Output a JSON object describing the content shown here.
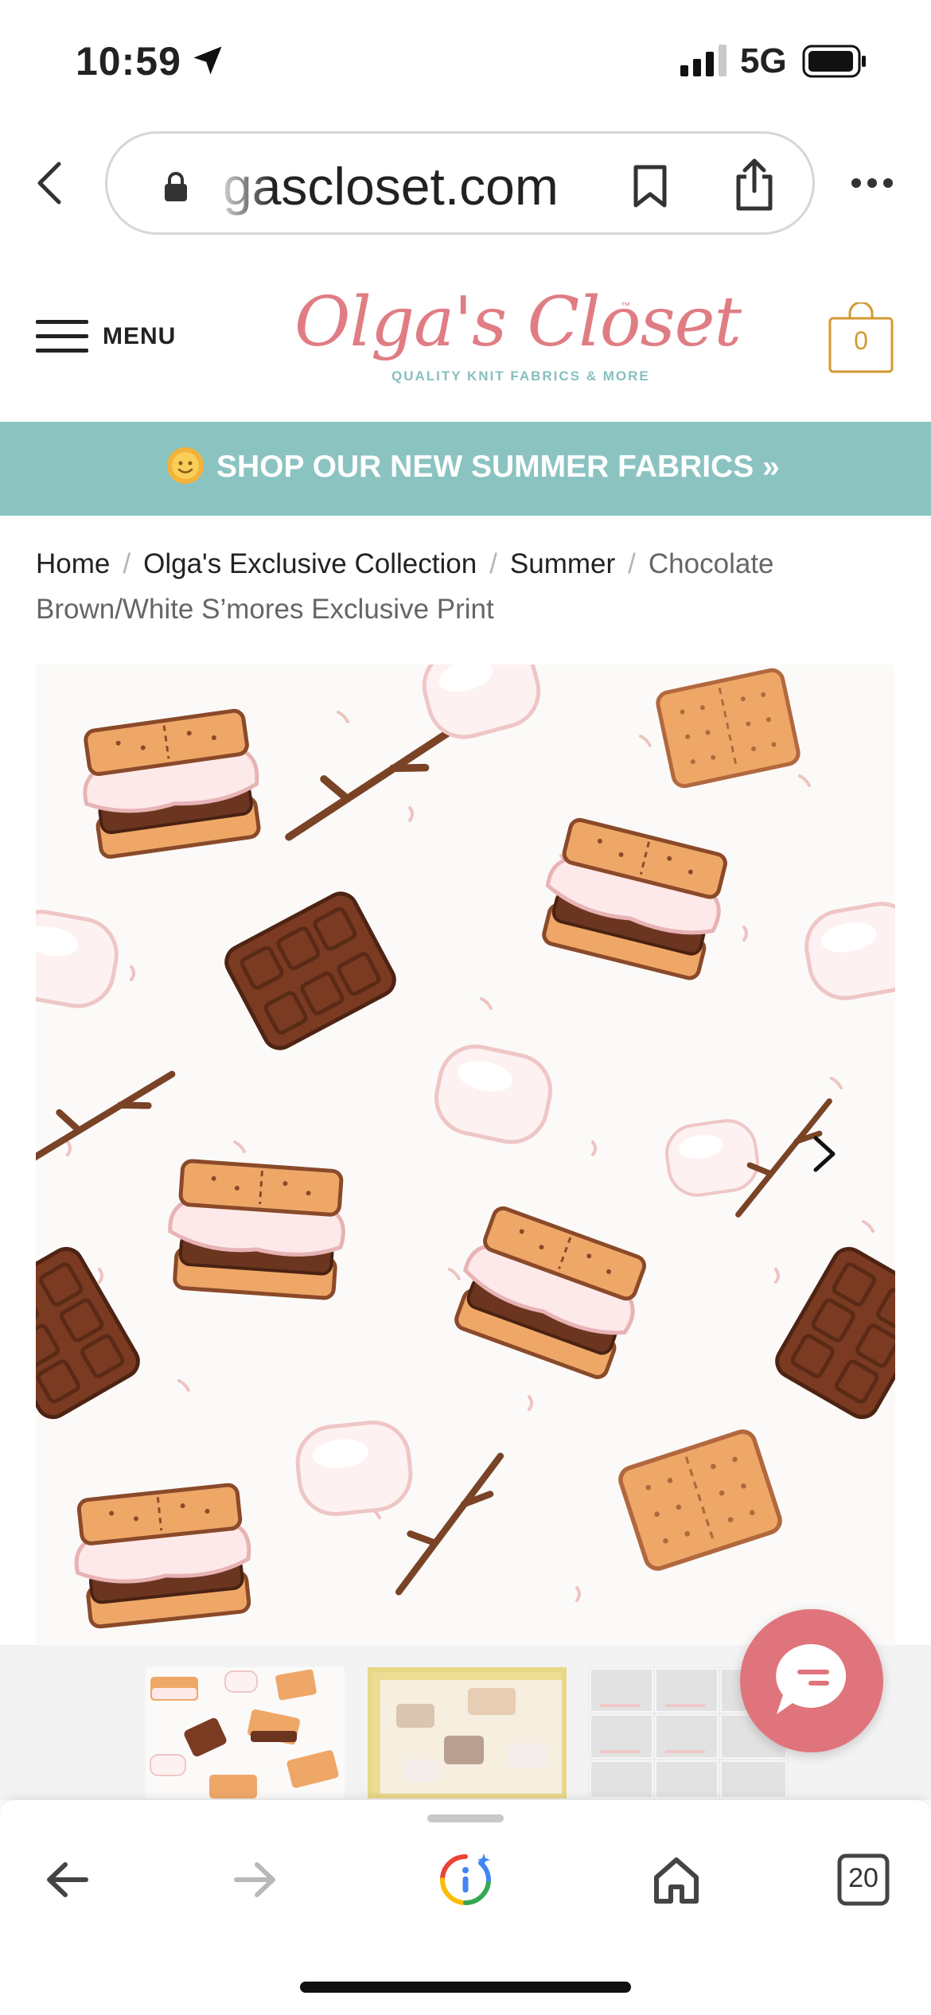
{
  "status_bar": {
    "time": "10:59",
    "network": "5G"
  },
  "browser": {
    "url": "gascloset.com",
    "tab_count": "20"
  },
  "header": {
    "menu_label": "MENU",
    "logo_script": "Olga's Closet",
    "logo_tm": "™",
    "logo_tagline": "QUALITY KNIT FABRICS & MORE",
    "cart_count": "0"
  },
  "banner": {
    "text": "SHOP OUR NEW SUMMER FABRICS »"
  },
  "breadcrumb": {
    "items": [
      "Home",
      "Olga's Exclusive Collection",
      "Summer"
    ],
    "separator": "/",
    "current": "Chocolate Brown/White S’mores Exclusive Print"
  },
  "colors": {
    "brand_pink": "#e07d84",
    "brand_teal": "#86bfbd",
    "banner_bg": "#8bc3c1",
    "cart_accent": "#d39a30",
    "chat_button": "#e0747c"
  },
  "icons": [
    "location-arrow-icon",
    "signal-icon",
    "battery-icon",
    "chevron-left-icon",
    "lock-icon",
    "bookmark-icon",
    "share-icon",
    "more-icon",
    "hamburger-icon",
    "cart-icon",
    "sun-icon",
    "chevron-right-icon",
    "chat-icon",
    "arrow-left-icon",
    "arrow-right-icon",
    "assistant-icon",
    "home-icon",
    "tabs-icon"
  ]
}
